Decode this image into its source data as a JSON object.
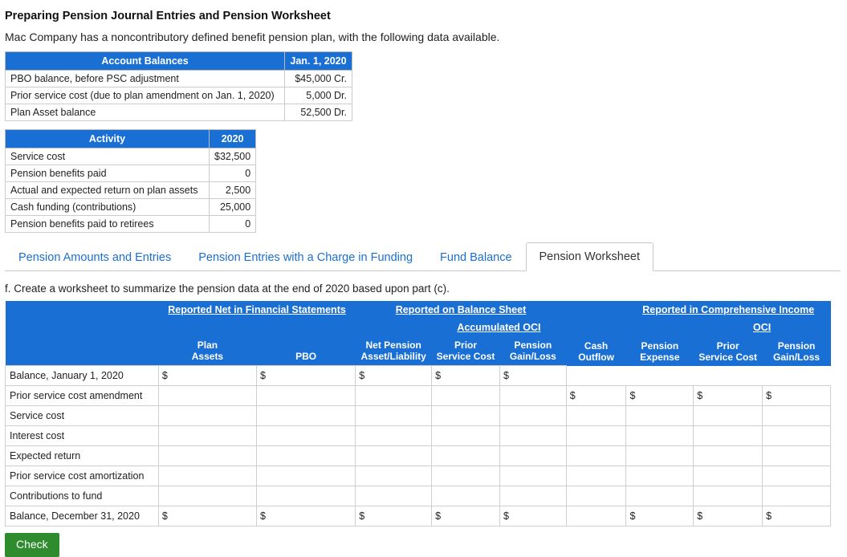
{
  "header": {
    "title": "Preparing Pension Journal Entries and Pension Worksheet",
    "intro": "Mac Company has a noncontributory defined benefit pension plan, with the following data available."
  },
  "account_balances_table": {
    "headers": [
      "Account Balances",
      "Jan. 1, 2020"
    ],
    "rows": [
      {
        "label": "PBO balance, before PSC adjustment",
        "value": "$45,000 Cr."
      },
      {
        "label": "Prior service cost (due to plan amendment on Jan. 1, 2020)",
        "value": "5,000 Dr."
      },
      {
        "label": "Plan Asset balance",
        "value": "52,500 Dr."
      }
    ]
  },
  "activity_table": {
    "headers": [
      "Activity",
      "2020"
    ],
    "rows": [
      {
        "label": "Service cost",
        "value": "$32,500"
      },
      {
        "label": "Pension benefits paid",
        "value": "0"
      },
      {
        "label": "Actual and expected return on plan assets",
        "value": "2,500"
      },
      {
        "label": "Cash funding (contributions)",
        "value": "25,000"
      },
      {
        "label": "Pension benefits paid to retirees",
        "value": "0"
      }
    ]
  },
  "tabs": [
    {
      "label": "Pension Amounts and Entries",
      "active": false
    },
    {
      "label": "Pension Entries with a Charge in Funding",
      "active": false
    },
    {
      "label": "Fund Balance",
      "active": false
    },
    {
      "label": "Pension Worksheet",
      "active": true
    }
  ],
  "prompt": "f. Create a worksheet to summarize the pension data at the end of 2020 based upon part (c).",
  "worksheet": {
    "group_headers": [
      "Reported Net in Financial Statements",
      "Reported on Balance Sheet",
      "Reported in Comprehensive Income"
    ],
    "sub_headers": [
      "Accumulated OCI",
      "OCI"
    ],
    "columns": [
      "Plan Assets",
      "PBO",
      "Net Pension Asset/Liability",
      "Prior Service Cost",
      "Pension Gain/Loss",
      "Cash Outflow",
      "Pension Expense",
      "Prior Service Cost",
      "Pension Gain/Loss"
    ],
    "column_lines": [
      [
        "Plan",
        "Assets"
      ],
      [
        "",
        "PBO"
      ],
      [
        "Net Pension",
        "Asset/Liability"
      ],
      [
        "Prior",
        "Service Cost"
      ],
      [
        "Pension",
        "Gain/Loss"
      ],
      [
        "Cash",
        "Outflow"
      ],
      [
        "Pension",
        "Expense"
      ],
      [
        "Prior",
        "Service Cost"
      ],
      [
        "Pension",
        "Gain/Loss"
      ]
    ],
    "rows": [
      {
        "label": "Balance, January 1, 2020",
        "cells": [
          "$",
          "$",
          "$",
          "$",
          "$",
          "",
          "",
          "",
          ""
        ]
      },
      {
        "label": "Prior service cost amendment",
        "cells": [
          "",
          "",
          "",
          "",
          "",
          "$",
          "$",
          "$",
          "$"
        ]
      },
      {
        "label": "Service cost",
        "cells": [
          "",
          "",
          "",
          "",
          "",
          "",
          "",
          "",
          ""
        ]
      },
      {
        "label": "Interest cost",
        "cells": [
          "",
          "",
          "",
          "",
          "",
          "",
          "",
          "",
          ""
        ]
      },
      {
        "label": "Expected return",
        "cells": [
          "",
          "",
          "",
          "",
          "",
          "",
          "",
          "",
          ""
        ]
      },
      {
        "label": "Prior service cost amortization",
        "cells": [
          "",
          "",
          "",
          "",
          "",
          "",
          "",
          "",
          ""
        ]
      },
      {
        "label": "Contributions to fund",
        "cells": [
          "",
          "",
          "",
          "",
          "",
          "",
          "",
          "",
          ""
        ]
      },
      {
        "label": "Balance, December 31, 2020",
        "cells": [
          "$",
          "$",
          "$",
          "$",
          "$",
          "",
          "$",
          "$",
          "$"
        ]
      }
    ]
  },
  "footer": {
    "check_label": "Check"
  },
  "colors": {
    "header_blue": "#1a6fd4",
    "link_blue": "#1a6fd4",
    "check_green": "#2e8b2e"
  }
}
